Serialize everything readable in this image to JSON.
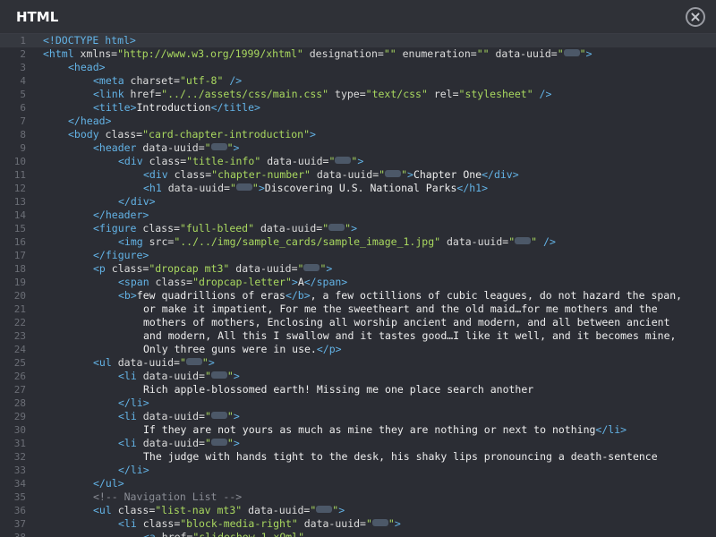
{
  "panel": {
    "title": "HTML"
  },
  "colors": {
    "tag": "#63b3e6",
    "string": "#a9d85f",
    "text": "#ededed",
    "comment": "#8a8d95",
    "background": "#2b2d34"
  },
  "editor": {
    "lines": [
      {
        "n": "1",
        "indent": 0,
        "active": true,
        "tokens": [
          [
            "t",
            "<!DOCTYPE html>"
          ]
        ]
      },
      {
        "n": "2",
        "indent": 0,
        "tokens": [
          [
            "t",
            "<html"
          ],
          [
            "a",
            " xmlns="
          ],
          [
            "s",
            "\"http://www.w3.org/1999/xhtml\""
          ],
          [
            "a",
            " designation="
          ],
          [
            "s",
            "\"\""
          ],
          [
            "a",
            " enumeration="
          ],
          [
            "s",
            "\"\""
          ],
          [
            "a",
            " data-uuid="
          ],
          [
            "s",
            "\""
          ],
          [
            "p",
            ""
          ],
          [
            "s",
            "\""
          ],
          [
            "t",
            ">"
          ]
        ]
      },
      {
        "n": "3",
        "indent": 1,
        "tokens": [
          [
            "t",
            "<head>"
          ]
        ]
      },
      {
        "n": "4",
        "indent": 2,
        "tokens": [
          [
            "t",
            "<meta"
          ],
          [
            "a",
            " charset="
          ],
          [
            "s",
            "\"utf-8\""
          ],
          [
            "t",
            " />"
          ]
        ]
      },
      {
        "n": "5",
        "indent": 2,
        "tokens": [
          [
            "t",
            "<link"
          ],
          [
            "a",
            " href="
          ],
          [
            "s",
            "\"../../assets/css/main.css\""
          ],
          [
            "a",
            " type="
          ],
          [
            "s",
            "\"text/css\""
          ],
          [
            "a",
            " rel="
          ],
          [
            "s",
            "\"stylesheet\""
          ],
          [
            "t",
            " />"
          ]
        ]
      },
      {
        "n": "6",
        "indent": 2,
        "tokens": [
          [
            "t",
            "<title>"
          ],
          [
            "x",
            "Introduction"
          ],
          [
            "t",
            "</title>"
          ]
        ]
      },
      {
        "n": "7",
        "indent": 1,
        "tokens": [
          [
            "t",
            "</head>"
          ]
        ]
      },
      {
        "n": "8",
        "indent": 1,
        "tokens": [
          [
            "t",
            "<body"
          ],
          [
            "a",
            " class="
          ],
          [
            "s",
            "\"card-chapter-introduction\""
          ],
          [
            "t",
            ">"
          ]
        ]
      },
      {
        "n": "9",
        "indent": 2,
        "tokens": [
          [
            "t",
            "<header"
          ],
          [
            "a",
            " data-uuid="
          ],
          [
            "s",
            "\""
          ],
          [
            "p",
            ""
          ],
          [
            "s",
            "\""
          ],
          [
            "t",
            ">"
          ]
        ]
      },
      {
        "n": "10",
        "indent": 3,
        "tokens": [
          [
            "t",
            "<div"
          ],
          [
            "a",
            " class="
          ],
          [
            "s",
            "\"title-info\""
          ],
          [
            "a",
            " data-uuid="
          ],
          [
            "s",
            "\""
          ],
          [
            "p",
            ""
          ],
          [
            "s",
            "\""
          ],
          [
            "t",
            ">"
          ]
        ]
      },
      {
        "n": "11",
        "indent": 4,
        "tokens": [
          [
            "t",
            "<div"
          ],
          [
            "a",
            " class="
          ],
          [
            "s",
            "\"chapter-number\""
          ],
          [
            "a",
            " data-uuid="
          ],
          [
            "s",
            "\""
          ],
          [
            "p",
            ""
          ],
          [
            "s",
            "\""
          ],
          [
            "t",
            ">"
          ],
          [
            "x",
            "Chapter One"
          ],
          [
            "t",
            "</div>"
          ]
        ]
      },
      {
        "n": "12",
        "indent": 4,
        "tokens": [
          [
            "t",
            "<h1"
          ],
          [
            "a",
            " data-uuid="
          ],
          [
            "s",
            "\""
          ],
          [
            "p",
            ""
          ],
          [
            "s",
            "\""
          ],
          [
            "t",
            ">"
          ],
          [
            "x",
            "Discovering U.S. National Parks"
          ],
          [
            "t",
            "</h1>"
          ]
        ]
      },
      {
        "n": "13",
        "indent": 3,
        "tokens": [
          [
            "t",
            "</div>"
          ]
        ]
      },
      {
        "n": "14",
        "indent": 2,
        "tokens": [
          [
            "t",
            "</header>"
          ]
        ]
      },
      {
        "n": "15",
        "indent": 2,
        "tokens": [
          [
            "t",
            "<figure"
          ],
          [
            "a",
            " class="
          ],
          [
            "s",
            "\"full-bleed\""
          ],
          [
            "a",
            " data-uuid="
          ],
          [
            "s",
            "\""
          ],
          [
            "p",
            ""
          ],
          [
            "s",
            "\""
          ],
          [
            "t",
            ">"
          ]
        ]
      },
      {
        "n": "16",
        "indent": 3,
        "tokens": [
          [
            "t",
            "<img"
          ],
          [
            "a",
            " src="
          ],
          [
            "s",
            "\"../../img/sample_cards/sample_image_1.jpg\""
          ],
          [
            "a",
            " data-uuid="
          ],
          [
            "s",
            "\""
          ],
          [
            "p",
            ""
          ],
          [
            "s",
            "\""
          ],
          [
            "t",
            " />"
          ]
        ]
      },
      {
        "n": "17",
        "indent": 2,
        "tokens": [
          [
            "t",
            "</figure>"
          ]
        ]
      },
      {
        "n": "18",
        "indent": 2,
        "tokens": [
          [
            "t",
            "<p"
          ],
          [
            "a",
            " class="
          ],
          [
            "s",
            "\"dropcap mt3\""
          ],
          [
            "a",
            " data-uuid="
          ],
          [
            "s",
            "\""
          ],
          [
            "p",
            ""
          ],
          [
            "s",
            "\""
          ],
          [
            "t",
            ">"
          ]
        ]
      },
      {
        "n": "19",
        "indent": 3,
        "tokens": [
          [
            "t",
            "<span"
          ],
          [
            "a",
            " class="
          ],
          [
            "s",
            "\"dropcap-letter\""
          ],
          [
            "t",
            ">"
          ],
          [
            "x",
            "A"
          ],
          [
            "t",
            "</span>"
          ]
        ]
      },
      {
        "n": "20",
        "indent": 3,
        "tokens": [
          [
            "t",
            "<b>"
          ],
          [
            "x",
            "few quadrillions of eras"
          ],
          [
            "t",
            "</b>"
          ],
          [
            "x",
            ", a few octillions of cubic leagues, do not hazard the span,"
          ]
        ]
      },
      {
        "n": "21",
        "indent": 4,
        "tokens": [
          [
            "x",
            "or make it impatient, For me the sweetheart and the old maid…for me mothers and the"
          ]
        ]
      },
      {
        "n": "22",
        "indent": 4,
        "tokens": [
          [
            "x",
            "mothers of mothers, Enclosing all worship ancient and modern, and all between ancient"
          ]
        ]
      },
      {
        "n": "23",
        "indent": 4,
        "tokens": [
          [
            "x",
            "and modern, All this I swallow and it tastes good…I like it well, and it becomes mine,"
          ]
        ]
      },
      {
        "n": "24",
        "indent": 4,
        "tokens": [
          [
            "x",
            "Only three guns were in use."
          ],
          [
            "t",
            "</p>"
          ]
        ]
      },
      {
        "n": "25",
        "indent": 2,
        "tokens": [
          [
            "t",
            "<ul"
          ],
          [
            "a",
            " data-uuid="
          ],
          [
            "s",
            "\""
          ],
          [
            "p",
            ""
          ],
          [
            "s",
            "\""
          ],
          [
            "t",
            ">"
          ]
        ]
      },
      {
        "n": "26",
        "indent": 3,
        "tokens": [
          [
            "t",
            "<li"
          ],
          [
            "a",
            " data-uuid="
          ],
          [
            "s",
            "\""
          ],
          [
            "p",
            ""
          ],
          [
            "s",
            "\""
          ],
          [
            "t",
            ">"
          ]
        ]
      },
      {
        "n": "27",
        "indent": 4,
        "tokens": [
          [
            "x",
            "Rich apple-blossomed earth! Missing me one place search another"
          ]
        ]
      },
      {
        "n": "28",
        "indent": 3,
        "tokens": [
          [
            "t",
            "</li>"
          ]
        ]
      },
      {
        "n": "29",
        "indent": 3,
        "tokens": [
          [
            "t",
            "<li"
          ],
          [
            "a",
            " data-uuid="
          ],
          [
            "s",
            "\""
          ],
          [
            "p",
            ""
          ],
          [
            "s",
            "\""
          ],
          [
            "t",
            ">"
          ]
        ]
      },
      {
        "n": "30",
        "indent": 4,
        "tokens": [
          [
            "x",
            "If they are not yours as much as mine they are nothing or next to nothing"
          ],
          [
            "t",
            "</li>"
          ]
        ]
      },
      {
        "n": "31",
        "indent": 3,
        "tokens": [
          [
            "t",
            "<li"
          ],
          [
            "a",
            " data-uuid="
          ],
          [
            "s",
            "\""
          ],
          [
            "p",
            ""
          ],
          [
            "s",
            "\""
          ],
          [
            "t",
            ">"
          ]
        ]
      },
      {
        "n": "32",
        "indent": 4,
        "tokens": [
          [
            "x",
            "The judge with hands tight to the desk, his shaky lips pronouncing a death-sentence"
          ]
        ]
      },
      {
        "n": "33",
        "indent": 3,
        "tokens": [
          [
            "t",
            "</li>"
          ]
        ]
      },
      {
        "n": "34",
        "indent": 2,
        "tokens": [
          [
            "t",
            "</ul>"
          ]
        ]
      },
      {
        "n": "35",
        "indent": 2,
        "tokens": [
          [
            "cm",
            "<!-- Navigation List -->"
          ]
        ]
      },
      {
        "n": "36",
        "indent": 2,
        "tokens": [
          [
            "t",
            "<ul"
          ],
          [
            "a",
            " class="
          ],
          [
            "s",
            "\"list-nav mt3\""
          ],
          [
            "a",
            " data-uuid="
          ],
          [
            "s",
            "\""
          ],
          [
            "p",
            ""
          ],
          [
            "s",
            "\""
          ],
          [
            "t",
            ">"
          ]
        ]
      },
      {
        "n": "37",
        "indent": 3,
        "tokens": [
          [
            "t",
            "<li"
          ],
          [
            "a",
            " class="
          ],
          [
            "s",
            "\"block-media-right\""
          ],
          [
            "a",
            " data-uuid="
          ],
          [
            "s",
            "\""
          ],
          [
            "p",
            ""
          ],
          [
            "s",
            "\""
          ],
          [
            "t",
            ">"
          ]
        ]
      },
      {
        "n": "38",
        "indent": 4,
        "tokens": [
          [
            "t",
            "<a"
          ],
          [
            "a",
            " href="
          ],
          [
            "s",
            "\"slideshow-1.xQml\""
          ]
        ]
      }
    ]
  }
}
